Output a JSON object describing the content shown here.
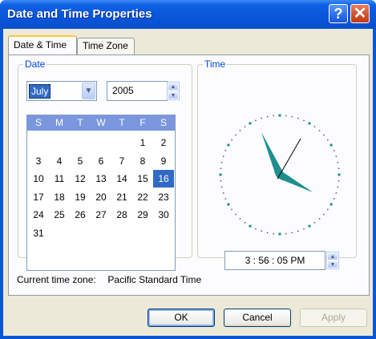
{
  "window": {
    "title": "Date and Time Properties"
  },
  "title_buttons": {
    "help": "?",
    "close": "✕"
  },
  "tabs": [
    {
      "label": "Date & Time",
      "active": true
    },
    {
      "label": "Time Zone",
      "active": false
    }
  ],
  "date_group": {
    "label": "Date",
    "month": "July",
    "year": "2005",
    "weekdays": [
      "S",
      "M",
      "T",
      "W",
      "T",
      "F",
      "S"
    ],
    "weeks": [
      [
        "",
        "",
        "",
        "",
        "",
        "1",
        "2"
      ],
      [
        "3",
        "4",
        "5",
        "6",
        "7",
        "8",
        "9"
      ],
      [
        "10",
        "11",
        "12",
        "13",
        "14",
        "15",
        "16"
      ],
      [
        "17",
        "18",
        "19",
        "20",
        "21",
        "22",
        "23"
      ],
      [
        "24",
        "25",
        "26",
        "27",
        "28",
        "29",
        "30"
      ],
      [
        "31",
        "",
        "",
        "",
        "",
        "",
        ""
      ]
    ],
    "selected_day": "16"
  },
  "time_group": {
    "label": "Time",
    "time_text": "3 : 56 : 05 PM",
    "clock": {
      "hour": 3,
      "minute": 56,
      "second": 5
    }
  },
  "current_zone": {
    "label": "Current time zone:",
    "value": "Pacific Standard Time"
  },
  "buttons": {
    "ok": "OK",
    "cancel": "Cancel",
    "apply": "Apply"
  },
  "colors": {
    "title_bar": "#0a55d8",
    "dialog_bg": "#ece9d8",
    "group_label": "#0046d5",
    "selection": "#316ac5",
    "calendar_header": "#7a96df",
    "clock_hands": "#1e8f8f",
    "tab_highlight": "#ffc83c"
  }
}
